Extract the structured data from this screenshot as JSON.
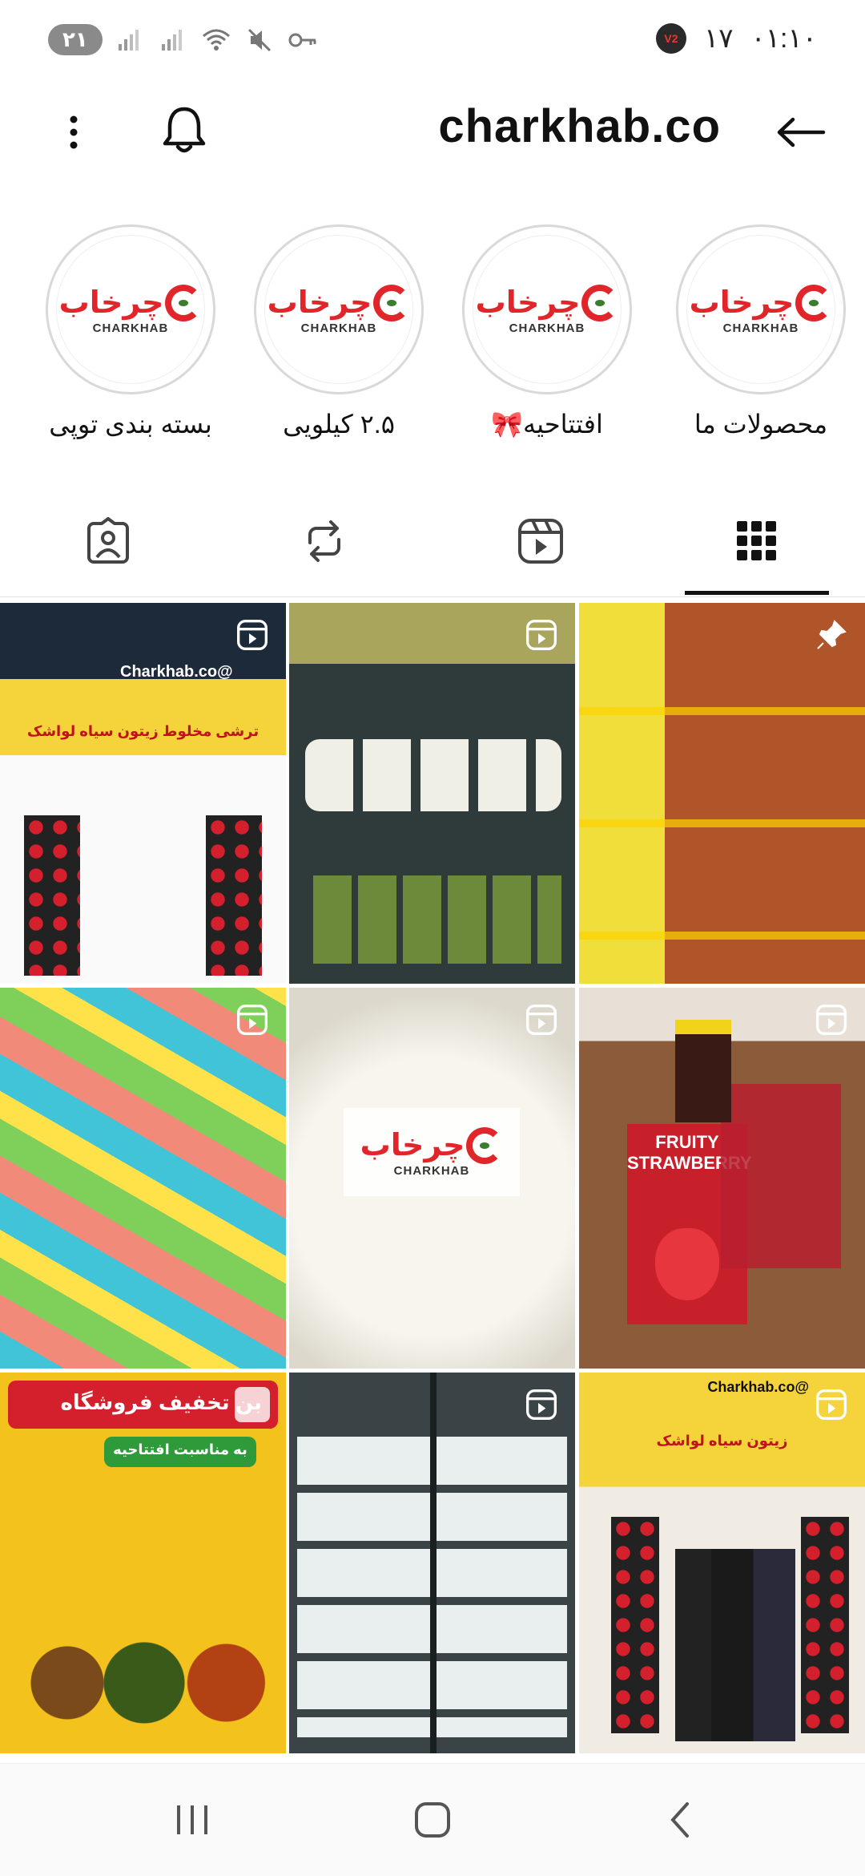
{
  "status": {
    "notification_count": "۲۱",
    "time": "۰۱:۱۰",
    "temperature": "۱۷",
    "v2_badge": "V2"
  },
  "header": {
    "title": "charkhab.co"
  },
  "highlights": [
    {
      "label": "محصولات ما"
    },
    {
      "label": "افتتاحیه🎀"
    },
    {
      "label": "۲.۵ کیلویی"
    },
    {
      "label": "بسته بندی توپی"
    }
  ],
  "brand": {
    "fa": "چرخاب",
    "en": "CHARKHAB"
  },
  "posts": [
    {
      "caption_fa": "ترشی مخلوط  زیتون سیاه  لواشک",
      "sub": "@Charkhab.co",
      "bg": "#f5d33a"
    },
    {
      "caption_fa": "",
      "sub": "",
      "bg": "#2f3a3a"
    },
    {
      "caption_fa": "",
      "sub": "",
      "bg": "#c98a2a"
    },
    {
      "caption_fa": "",
      "sub": "",
      "bg": "#e86a4a"
    },
    {
      "caption_fa": "",
      "sub": "",
      "bg": "#e8e4dc"
    },
    {
      "caption_fa": "FRUITY STRAWBERRY",
      "sub": "",
      "bg": "#8b5b3a"
    },
    {
      "caption_fa": "بن تخفیف فروشگاه",
      "sub": "به مناسبت افتتاحیه",
      "bg": "#f4c21c"
    },
    {
      "caption_fa": "",
      "sub": "",
      "bg": "#3a4446"
    },
    {
      "caption_fa": "زیتون سیاه  لواشک",
      "sub": "@Charkhab.co",
      "bg": "#f5d33a"
    }
  ],
  "colors": {
    "brand_red": "#e0262b",
    "tab_active": "#111111"
  }
}
